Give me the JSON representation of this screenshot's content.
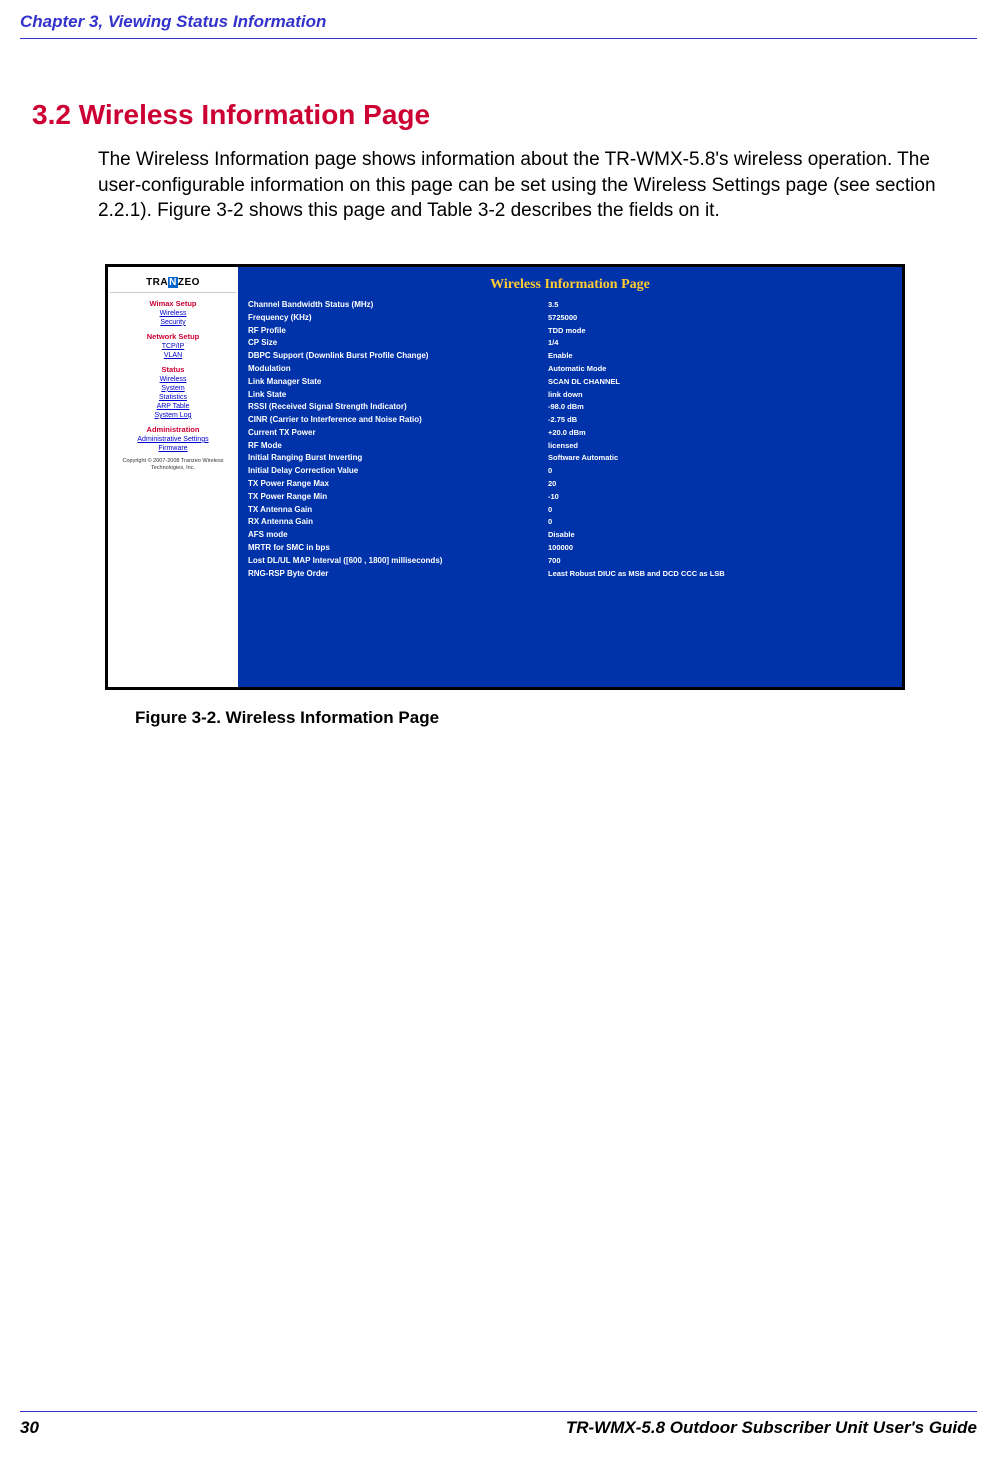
{
  "header": {
    "chapter_title": "Chapter 3, Viewing Status Information"
  },
  "section": {
    "heading": "3.2 Wireless Information Page",
    "body": "The Wireless Information page shows information about the TR-WMX-5.8's wireless operation. The user-configurable information on this page can be set using the Wireless Settings page (see section 2.2.1). Figure 3-2 shows this page and Table 3-2 describes the fields on it."
  },
  "figure": {
    "caption": "Figure 3-2. Wireless Information Page",
    "logo_pre": "TRA",
    "logo_mid": "N",
    "logo_post": "ZEO",
    "panel_title": "Wireless Information Page",
    "nav": {
      "wimax_title": "Wimax Setup",
      "wimax_items": [
        "Wireless",
        "Security"
      ],
      "network_title": "Network Setup",
      "network_items": [
        "TCP/IP",
        "VLAN"
      ],
      "status_title": "Status",
      "status_items": [
        "Wireless",
        "System",
        "Statistics",
        "ARP Table",
        "System Log"
      ],
      "admin_title": "Administration",
      "admin_items": [
        "Administrative Settings",
        "Firmware"
      ],
      "copyright": "Copyright © 2007-2008 Tranzeo Wireless Technologies, Inc."
    },
    "rows": [
      {
        "label": "Channel Bandwidth Status (MHz)",
        "value": "3.5"
      },
      {
        "label": "Frequency (KHz)",
        "value": "5725000"
      },
      {
        "label": "RF Profile",
        "value": "TDD mode"
      },
      {
        "label": "CP Size",
        "value": "1/4"
      },
      {
        "label": "DBPC Support (Downlink Burst Profile Change)",
        "value": "Enable"
      },
      {
        "label": "Modulation",
        "value": "Automatic Mode"
      },
      {
        "label": "Link Manager State",
        "value": "SCAN DL CHANNEL"
      },
      {
        "label": "Link State",
        "value": "link down"
      },
      {
        "label": "RSSI (Received Signal Strength Indicator)",
        "value": "-98.0 dBm"
      },
      {
        "label": "CINR (Carrier to Interference and Noise Ratio)",
        "value": "-2.75 dB"
      },
      {
        "label": "Current TX Power",
        "value": "+20.0 dBm"
      },
      {
        "label": "RF Mode",
        "value": "licensed"
      },
      {
        "label": "Initial Ranging Burst Inverting",
        "value": "Software Automatic"
      },
      {
        "label": "Initial Delay Correction Value",
        "value": "0"
      },
      {
        "label": "TX Power Range Max",
        "value": "20"
      },
      {
        "label": "TX Power Range Min",
        "value": "-10"
      },
      {
        "label": "TX Antenna Gain",
        "value": "0"
      },
      {
        "label": "RX Antenna Gain",
        "value": "0"
      },
      {
        "label": "AFS mode",
        "value": "Disable"
      },
      {
        "label": "MRTR for SMC in bps",
        "value": "100000"
      },
      {
        "label": "Lost DL/UL MAP Interval ([600 , 1800] milliseconds)",
        "value": "700"
      },
      {
        "label": "RNG-RSP Byte Order",
        "value": "Least Robust DIUC as MSB and DCD CCC as LSB"
      }
    ]
  },
  "footer": {
    "page_number": "30",
    "guide_title": "TR-WMX-5.8 Outdoor Subscriber Unit User's Guide"
  }
}
